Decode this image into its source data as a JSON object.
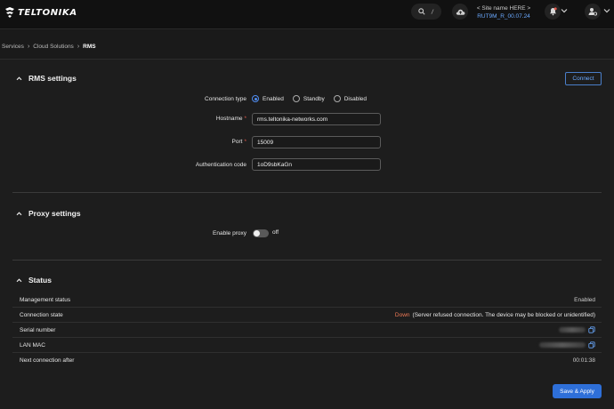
{
  "header": {
    "brand": "TELTONIKA",
    "search_shortcut": "/",
    "site_name": "< Site name HERE >",
    "firmware": "RUT9M_R_00.07.24"
  },
  "breadcrumb": {
    "items": [
      "Services",
      "Cloud Solutions",
      "RMS"
    ]
  },
  "rms_settings": {
    "title": "RMS settings",
    "connect_label": "Connect",
    "connection_type_label": "Connection type",
    "options": [
      "Enabled",
      "Standby",
      "Disabled"
    ],
    "selected_option": "Enabled",
    "hostname_label": "Hostname",
    "hostname_value": "rms.teltonika-networks.com",
    "port_label": "Port",
    "port_value": "15009",
    "auth_label": "Authentication code",
    "auth_value": "1oD9sbKaGn",
    "required_mark": "*"
  },
  "proxy_settings": {
    "title": "Proxy settings",
    "enable_proxy_label": "Enable proxy",
    "enable_proxy_state": "off"
  },
  "status": {
    "title": "Status",
    "management_status_label": "Management status",
    "management_status_value": "Enabled",
    "connection_state_label": "Connection state",
    "connection_state_value": "Down",
    "connection_state_detail": "(Server refused connection. The device may be blocked or unidentified)",
    "serial_number_label": "Serial number",
    "lan_mac_label": "LAN MAC",
    "next_connection_label": "Next connection after",
    "next_connection_value": "00:01:38"
  },
  "footer": {
    "save_label": "Save & Apply"
  },
  "colors": {
    "accent": "#2e6fd8",
    "link": "#6aa9ff",
    "danger": "#f07a56",
    "required": "#e0584b"
  },
  "icons": [
    "search-icon",
    "cloud-upload-icon",
    "bell-icon",
    "user-settings-icon",
    "chevron-down-icon",
    "chevron-up-icon",
    "copy-icon",
    "chevron-right-icon"
  ]
}
